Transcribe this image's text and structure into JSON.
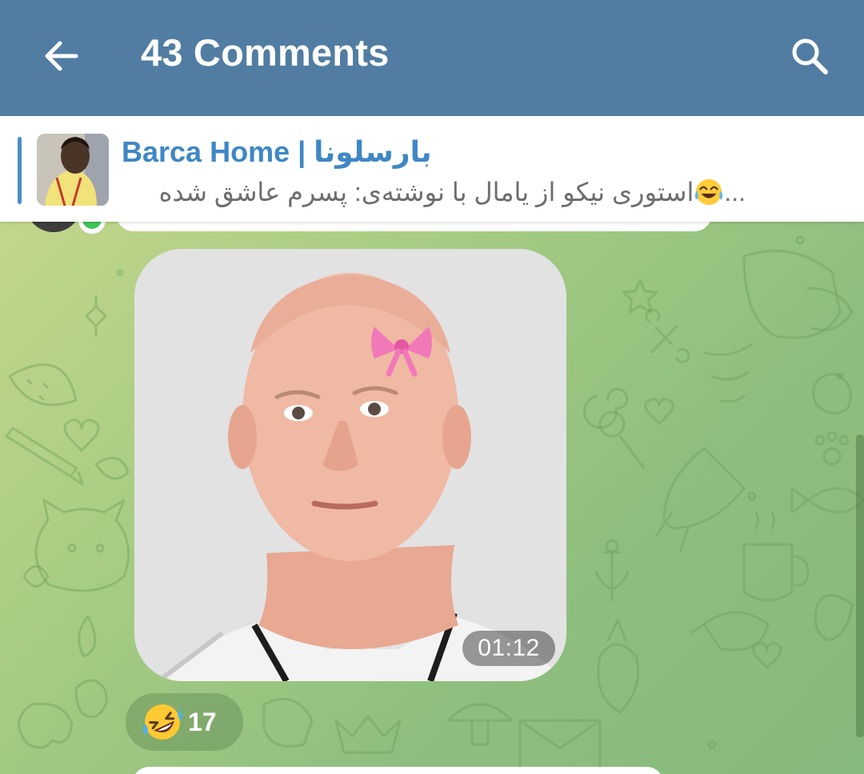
{
  "appbar": {
    "title": "43 Comments",
    "back_icon": "arrow-left-icon",
    "search_icon": "search-icon",
    "color": "#517da2"
  },
  "reply": {
    "channel": "Barca Home | بارسلونا",
    "text": "استوری نیکو از یامال  با نوشته‌ی: پسرم عاشق شده",
    "ellipsis": "...",
    "accent": "#3f87c4"
  },
  "video": {
    "duration": "01:12"
  },
  "reaction": {
    "emoji": "rolling-on-floor-laughing",
    "count": "17"
  },
  "colors": {
    "online": "#3fc55b",
    "background": "#a8cc84"
  }
}
